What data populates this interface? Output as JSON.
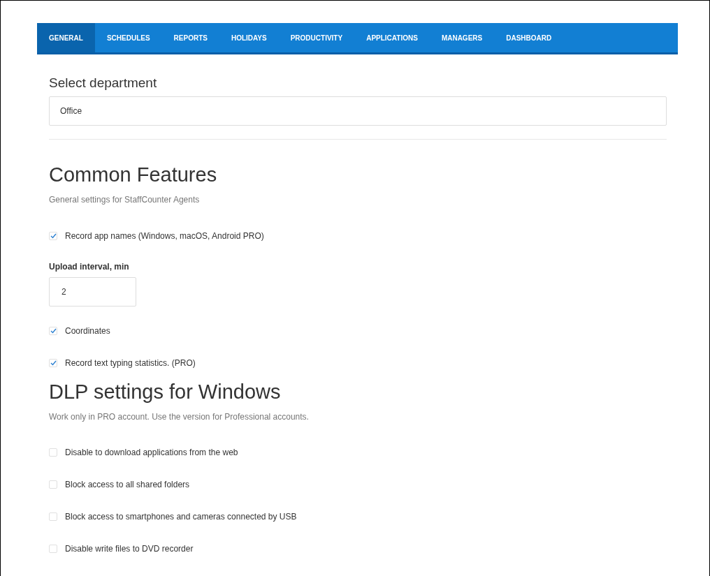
{
  "nav": {
    "tabs": [
      {
        "label": "GENERAL",
        "selected": true
      },
      {
        "label": "SCHEDULES",
        "selected": false
      },
      {
        "label": "REPORTS",
        "selected": false
      },
      {
        "label": "HOLIDAYS",
        "selected": false
      },
      {
        "label": "PRODUCTIVITY",
        "selected": false
      },
      {
        "label": "APPLICATIONS",
        "selected": false
      },
      {
        "label": "MANAGERS",
        "selected": false
      },
      {
        "label": "DASHBOARD",
        "selected": false
      }
    ]
  },
  "department": {
    "label": "Select department",
    "value": "Office"
  },
  "sections": [
    {
      "title": "Common Features",
      "subtitle": "General settings for StaffCounter Agents",
      "items": [
        {
          "kind": "checkbox",
          "label": "Record app names (Windows, macOS, Android PRO)",
          "checked": true
        },
        {
          "kind": "number",
          "label": "Upload interval, min",
          "value": "2"
        },
        {
          "kind": "checkbox",
          "label": "Coordinates",
          "checked": true
        },
        {
          "kind": "checkbox",
          "label": "Record text typing statistics. (PRO)",
          "checked": true
        }
      ]
    },
    {
      "title": "DLP settings for Windows",
      "subtitle": "Work only in PRO account. Use the version for Professional accounts.",
      "items": [
        {
          "kind": "checkbox",
          "label": "Disable to download applications from the web",
          "checked": false
        },
        {
          "kind": "checkbox",
          "label": "Block access to all shared folders",
          "checked": false
        },
        {
          "kind": "checkbox",
          "label": "Block access to smartphones and cameras connected by USB",
          "checked": false
        },
        {
          "kind": "checkbox",
          "label": "Disable write files to DVD recorder",
          "checked": false
        }
      ]
    }
  ]
}
